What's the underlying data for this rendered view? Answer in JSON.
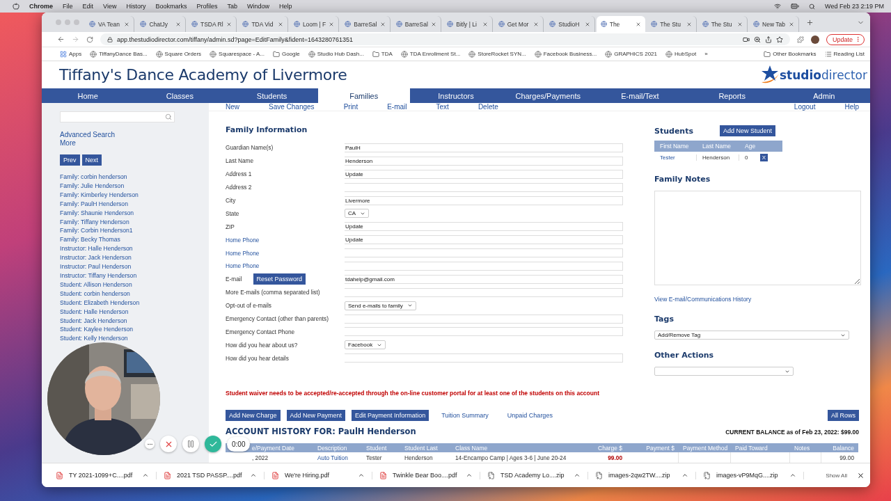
{
  "menubar": {
    "app": "Chrome",
    "menus": [
      "File",
      "Edit",
      "View",
      "History",
      "Bookmarks",
      "Profiles",
      "Tab",
      "Window",
      "Help"
    ],
    "clock": "Wed Feb 23  2:19 PM"
  },
  "browser": {
    "tabs": [
      {
        "label": "VA Tean",
        "selected": false
      },
      {
        "label": "ChatJy",
        "selected": false
      },
      {
        "label": "TSDA Rl",
        "selected": false
      },
      {
        "label": "TDA Vid",
        "selected": false
      },
      {
        "label": "Loom | F",
        "selected": false
      },
      {
        "label": "BarreSal",
        "selected": false
      },
      {
        "label": "BarreSal",
        "selected": false
      },
      {
        "label": "Bitly | Li",
        "selected": false
      },
      {
        "label": "Get Mor",
        "selected": false
      },
      {
        "label": "StudioH",
        "selected": false
      },
      {
        "label": "The",
        "selected": true
      },
      {
        "label": "The Stu",
        "selected": false
      },
      {
        "label": "The Stu",
        "selected": false
      },
      {
        "label": "New Tab",
        "selected": false
      }
    ],
    "url": "app.thestudiodirector.com/tiffany/admin.sd?page=EditFamily&fident=1643280761351",
    "update_button": "Update",
    "bookmarks": [
      {
        "label": "Apps",
        "kind": "apps"
      },
      {
        "label": "TiffanyDance Bas...",
        "kind": "site"
      },
      {
        "label": "Square Orders",
        "kind": "site"
      },
      {
        "label": "Squarespace - A...",
        "kind": "site"
      },
      {
        "label": "Google",
        "kind": "folder"
      },
      {
        "label": "Studio Hub Dash...",
        "kind": "site"
      },
      {
        "label": "TDA",
        "kind": "folder"
      },
      {
        "label": "TDA Enrollment St...",
        "kind": "site"
      },
      {
        "label": "StoreRocket SYN...",
        "kind": "site"
      },
      {
        "label": "Facebook Business...",
        "kind": "site"
      },
      {
        "label": "GRAPHICS 2021",
        "kind": "site"
      },
      {
        "label": "HubSpot",
        "kind": "site"
      },
      {
        "label": "»",
        "kind": "more"
      },
      {
        "label": "Other Bookmarks",
        "kind": "folder"
      },
      {
        "label": "Reading List",
        "kind": "list"
      }
    ]
  },
  "site": {
    "title": "Tiffany's Dance Academy of Livermore",
    "logo": "**studio**director",
    "nav": [
      {
        "label": "Home",
        "selected": false
      },
      {
        "label": "Classes",
        "selected": false
      },
      {
        "label": "Students",
        "selected": false
      },
      {
        "label": "Families",
        "selected": true
      },
      {
        "label": "Instructors",
        "selected": false
      },
      {
        "label": "Charges/Payments",
        "selected": false
      },
      {
        "label": "E-mail/Text",
        "selected": false
      },
      {
        "label": "Reports",
        "selected": false
      },
      {
        "label": "Admin",
        "selected": false
      }
    ],
    "toolbar": [
      "New",
      "Save Changes",
      "Print",
      "E-mail",
      "Text",
      "Delete"
    ],
    "toolbar_right": [
      "Logout",
      "Help"
    ]
  },
  "sidebar": {
    "links": [
      "Advanced Search",
      "More"
    ],
    "pager": [
      "Prev",
      "Next"
    ],
    "results": [
      "Family: corbin henderson",
      "Family: Julie Henderson",
      "Family: Kimberley Henderson",
      "Family: PaulH Henderson",
      "Family: Shaunie Henderson",
      "Family: Tiffany Henderson",
      "Family: Corbin Henderson1",
      "Family: Becky Thomas",
      "Instructor: Halle Henderson",
      "Instructor: Jack Henderson",
      "Instructor: Paul Henderson",
      "Instructor: Tiffany Henderson",
      "Student: Allison Henderson",
      "Student: corbin henderson",
      "Student: Elizabeth Henderson",
      "Student: Halle Henderson",
      "Student: Jack Henderson",
      "Student: Kaylee Henderson",
      "Student: Kelly Henderson"
    ]
  },
  "family_info": {
    "title": "Family Information",
    "fields": [
      {
        "label": "Guardian Name(s)",
        "kind": "text",
        "value": "PaulH",
        "link": false
      },
      {
        "label": "Last Name",
        "kind": "text",
        "value": "Henderson",
        "link": false
      },
      {
        "label": "Address 1",
        "kind": "text",
        "value": "Update",
        "link": false
      },
      {
        "label": "Address 2",
        "kind": "text",
        "link": false
      },
      {
        "label": "City",
        "kind": "text",
        "value": "Livermore",
        "link": false
      },
      {
        "label": "State",
        "kind": "select",
        "value": "CA",
        "link": false
      },
      {
        "label": "ZIP",
        "kind": "text",
        "value": "Update",
        "link": false
      },
      {
        "label": "Home Phone",
        "kind": "text",
        "value": "Update",
        "link": true
      },
      {
        "label": "Home Phone",
        "kind": "text",
        "link": true
      },
      {
        "label": "Home Phone",
        "kind": "text",
        "link": true
      },
      {
        "label": "E-mail",
        "kind": "email",
        "button": "Reset Password",
        "value": "tdahelp@gmail.com",
        "link": false
      },
      {
        "label": "More E-mails (comma separated list)",
        "kind": "text",
        "link": false
      },
      {
        "label": "Opt-out of e-mails",
        "kind": "select",
        "value": "Send e-mails to family",
        "link": false
      },
      {
        "label": "Emergency Contact (other than parents)",
        "kind": "text",
        "link": false
      },
      {
        "label": "Emergency Contact Phone",
        "kind": "text",
        "link": false
      },
      {
        "label": "How did you hear about us?",
        "kind": "select",
        "value": "Facebook",
        "link": false
      },
      {
        "label": "How did you hear details",
        "kind": "text",
        "link": false
      }
    ]
  },
  "students": {
    "title": "Students",
    "add_button": "Add New Student",
    "columns": [
      "First Name",
      "Last Name",
      "Age"
    ],
    "rows": [
      {
        "first": "Tester",
        "last": "Henderson",
        "age": "0",
        "remove": "X"
      }
    ]
  },
  "family_notes": {
    "title": "Family Notes",
    "history_link": "View E-mail/Communications History"
  },
  "tags": {
    "title": "Tags",
    "select": "Add/Remove Tag"
  },
  "other_actions": {
    "title": "Other Actions"
  },
  "warning": "Student waiver needs to be accepted/re-accepted through the on-line customer portal for at least one of the students on this account",
  "actions": [
    {
      "label": "Add New Charge",
      "kind": "button"
    },
    {
      "label": "Add New Payment",
      "kind": "button"
    },
    {
      "label": "Edit Payment Information",
      "kind": "button"
    },
    {
      "label": "Tuition Summary",
      "kind": "link"
    },
    {
      "label": "Unpaid Charges",
      "kind": "link"
    }
  ],
  "all_rows": "All Rows",
  "history": {
    "title": "ACCOUNT HISTORY FOR: PaulH Henderson",
    "balance": "CURRENT BALANCE as of Feb 23, 2022: $99.00",
    "columns": [
      "e/Payment Date",
      "Description",
      "Student",
      "Student Last",
      "Class Name",
      "Charge $",
      "Payment $",
      "Payment Method",
      "Paid Toward",
      "Notes",
      "Balance"
    ],
    "rows": [
      {
        "cells": [
          {
            "text": ", 2022",
            "kind": "plain"
          },
          {
            "text": "Auto Tuition",
            "kind": "link"
          },
          {
            "text": "Tester",
            "kind": "plain"
          },
          {
            "text": "Henderson",
            "kind": "plain"
          },
          {
            "text": "14-Encampo Camp | Ages 3-6 | June 20-24",
            "kind": "plain"
          },
          {
            "text": "99.00",
            "kind": "charge"
          },
          null,
          null,
          null,
          null,
          {
            "text": "99.00",
            "kind": "plain"
          }
        ]
      }
    ]
  },
  "recorder": {
    "timer": "0:00"
  },
  "downloads": {
    "items": [
      {
        "name": "TY 2021-1099+C....pdf",
        "kind": "pdf"
      },
      {
        "name": "2021 TSD PASSP....pdf",
        "kind": "pdf"
      },
      {
        "name": "We're Hiring.pdf",
        "kind": "pdf"
      },
      {
        "name": "Twinkle Bear Boo....pdf",
        "kind": "pdf"
      },
      {
        "name": "TSD Academy Lo....zip",
        "kind": "zip"
      },
      {
        "name": "images-2qw2TW....zip",
        "kind": "zip"
      },
      {
        "name": "images-vP9MqG....zip",
        "kind": "zip"
      }
    ],
    "show_all": "Show All"
  }
}
